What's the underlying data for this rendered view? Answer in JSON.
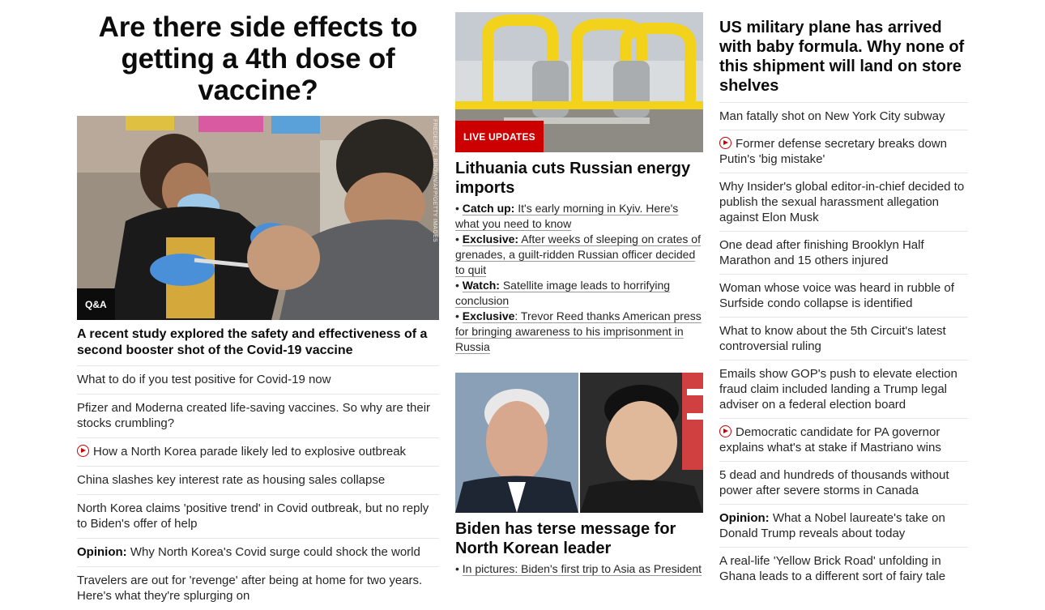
{
  "col1": {
    "headline": "Are there side effects to getting a 4th dose of vaccine?",
    "image": {
      "tag": "Q&A",
      "credit": "FREDERIC J. BROWN/AFP/GETTY IMAGES"
    },
    "subheadline": "A recent study explored the safety and effectiveness of a second booster shot of the Covid-19 vaccine",
    "links": [
      {
        "text": "What to do if you test positive for Covid-19 now",
        "video": false,
        "label": ""
      },
      {
        "text": "Pfizer and Moderna created life-saving vaccines. So why are their stocks crumbling?",
        "video": false,
        "label": ""
      },
      {
        "text": "How a North Korea parade likely led to explosive outbreak",
        "video": true,
        "label": ""
      },
      {
        "text": "China slashes key interest rate as housing sales collapse",
        "video": false,
        "label": ""
      },
      {
        "text": "North Korea claims 'positive trend' in Covid outbreak, but no reply to Biden's offer of help",
        "video": false,
        "label": ""
      },
      {
        "text": "Why North Korea's Covid surge could shock the world",
        "video": false,
        "label": "Opinion:"
      },
      {
        "text": "Travelers are out for 'revenge' after being at home for two years. Here's what they're splurging on",
        "video": false,
        "label": ""
      }
    ]
  },
  "col2": {
    "story1": {
      "tag": "LIVE UPDATES",
      "headline": "Lithuania cuts Russian energy imports",
      "bullets": [
        {
          "label": "Catch up:",
          "text": "It's early morning in Kyiv. Here's what you need to know"
        },
        {
          "label": "Exclusive:",
          "text": "After weeks of sleeping on crates of grenades, a guilt-ridden Russian officer decided to quit"
        },
        {
          "label": "Watch:",
          "text": "Satellite image leads to horrifying conclusion"
        },
        {
          "label": "Exclusive",
          "text": ": Trevor Reed thanks American press for bringing awareness to his imprisonment in Russia"
        }
      ]
    },
    "story2": {
      "headline": "Biden has terse message for North Korean leader",
      "bullets": [
        {
          "label": "",
          "text": "In pictures: Biden's first trip to Asia as President"
        }
      ]
    }
  },
  "col3": {
    "headline": "US military plane has arrived with baby formula. Why none of this shipment will land on store shelves",
    "links": [
      {
        "text": "Man fatally shot on New York City subway",
        "video": false,
        "label": ""
      },
      {
        "text": "Former defense secretary breaks down Putin's 'big mistake'",
        "video": true,
        "label": ""
      },
      {
        "text": "Why Insider's global editor-in-chief decided to publish the sexual harassment allegation against Elon Musk",
        "video": false,
        "label": ""
      },
      {
        "text": "One dead after finishing Brooklyn Half Marathon and 15 others injured",
        "video": false,
        "label": ""
      },
      {
        "text": "Woman whose voice was heard in rubble of Surfside condo collapse is identified",
        "video": false,
        "label": ""
      },
      {
        "text": "What to know about the 5th Circuit's latest controversial ruling",
        "video": false,
        "label": ""
      },
      {
        "text": "Emails show GOP's push to elevate election fraud claim included landing a Trump legal adviser on a federal election board",
        "video": false,
        "label": ""
      },
      {
        "text": "Democratic candidate for PA governor explains what's at stake if Mastriano wins",
        "video": true,
        "label": ""
      },
      {
        "text": "5 dead and hundreds of thousands without power after severe storms in Canada",
        "video": false,
        "label": ""
      },
      {
        "text": "What a Nobel laureate's take on Donald Trump reveals about today",
        "video": false,
        "label": "Opinion:"
      },
      {
        "text": "A real-life 'Yellow Brick Road' unfolding in Ghana leads to a different sort of fairy tale",
        "video": false,
        "label": ""
      }
    ]
  },
  "colors": {
    "accent_red": "#cc0000",
    "text": "#0c0c0c",
    "divider": "#e6e6e6"
  }
}
